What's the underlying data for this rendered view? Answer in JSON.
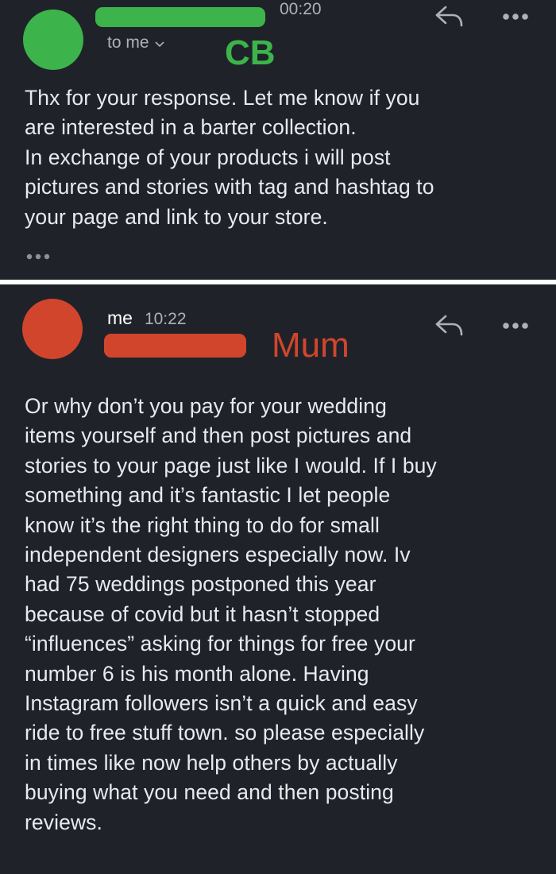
{
  "email1": {
    "time": "00:20",
    "recipient": "to me",
    "annotation": "CB",
    "body_lines": [
      "Thx for your response.  Let me know if you",
      "are interested in a barter collection.",
      "In exchange of your products i will post",
      "pictures and stories with tag and hashtag to",
      "your page and link to your store."
    ],
    "icons": {
      "reply": "reply-icon",
      "more": "more-icon",
      "expand": "ellipsis-icon",
      "dropdown": "chevron-down-icon"
    },
    "colors": {
      "avatar": "#3cb44b",
      "redaction": "#3cb44b",
      "annotation": "#3cb44b"
    }
  },
  "email2": {
    "sender": "me",
    "time": "10:22",
    "annotation": "Mum",
    "body_lines": [
      "Or why don’t you pay for your wedding",
      "items yourself and then post pictures and",
      "stories to your page just like I would. If I buy",
      "something and it’s fantastic I let people",
      "know it’s the right thing to do for small",
      "independent designers especially now. Iv",
      "had 75 weddings postponed this year",
      "because of covid but it hasn’t stopped",
      "“influences” asking for things for free your",
      "number 6 is his month alone. Having",
      "Instagram followers isn’t a quick and easy",
      "ride to free stuff town. so please especially",
      "in times like now help others by actually",
      "buying what you need and then posting",
      "reviews."
    ],
    "icons": {
      "reply": "reply-icon",
      "more": "more-icon"
    },
    "colors": {
      "avatar": "#d2452d",
      "redaction": "#d2452d",
      "annotation": "#d2452d"
    }
  },
  "colors": {
    "background": "#1f2329",
    "divider": "#ffffff",
    "text": "#e8eaed",
    "secondary_text": "#aeb2b8"
  }
}
